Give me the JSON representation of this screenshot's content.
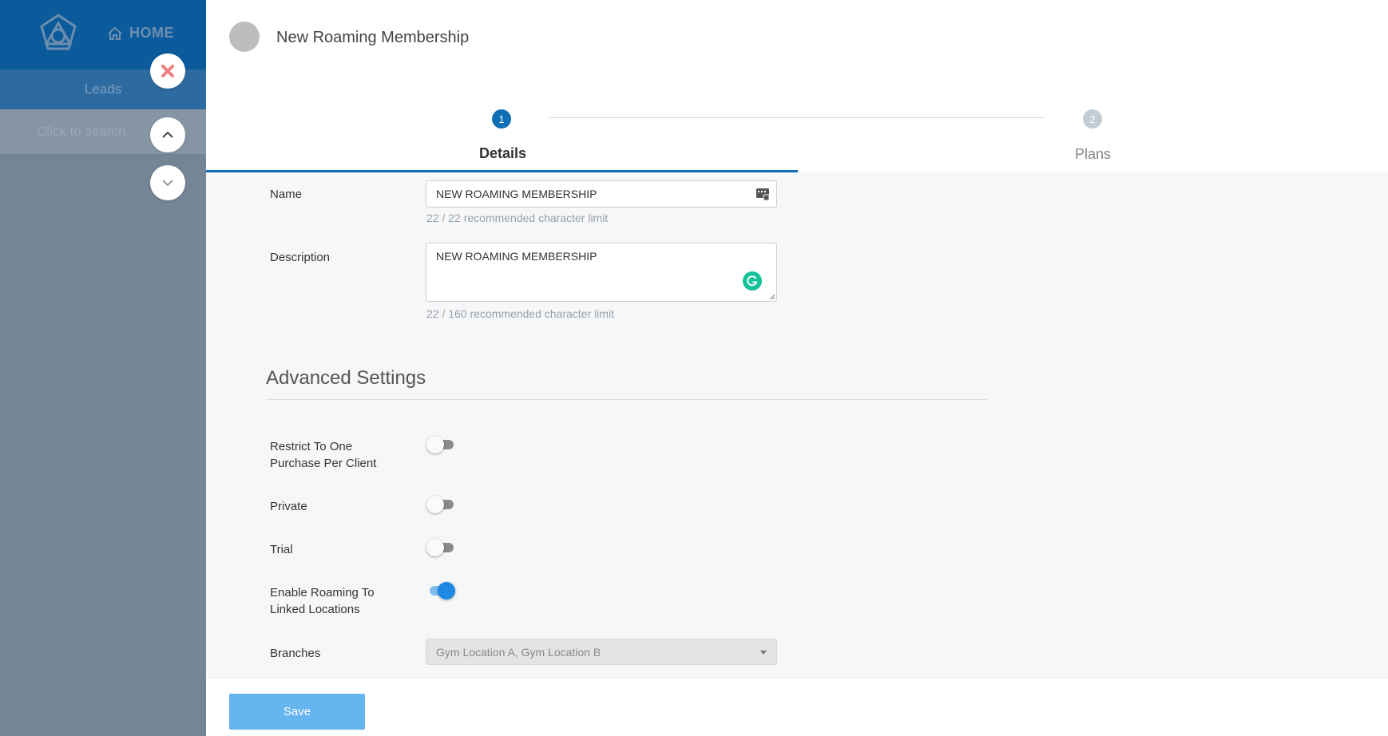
{
  "sidebar": {
    "home_label": "HOME",
    "leads_label": "Leads",
    "search_placeholder": "Click to search"
  },
  "icons": {
    "logo": "brand-logo-icon",
    "home": "home-icon",
    "close": "close-icon",
    "up": "chevron-up-icon",
    "down": "chevron-down-icon",
    "grammarly": "grammarly-icon",
    "password_manager": "password-manager-icon"
  },
  "header": {
    "title": "New Roaming Membership"
  },
  "stepper": {
    "steps": [
      {
        "number": "1",
        "label": "Details",
        "active": true
      },
      {
        "number": "2",
        "label": "Plans",
        "active": false
      }
    ]
  },
  "form": {
    "name": {
      "label": "Name",
      "value": "NEW ROAMING MEMBERSHIP",
      "hint": "22 / 22 recommended character limit"
    },
    "description": {
      "label": "Description",
      "value": "NEW ROAMING MEMBERSHIP",
      "hint": "22 / 160 recommended character limit"
    },
    "advanced": {
      "title": "Advanced Settings",
      "toggles": [
        {
          "label_line1": "Restrict To One",
          "label_line2": "Purchase Per Client",
          "on": false
        },
        {
          "label_line1": "Private",
          "label_line2": "",
          "on": false
        },
        {
          "label_line1": "Trial",
          "label_line2": "",
          "on": false
        },
        {
          "label_line1": "Enable Roaming To",
          "label_line2": "Linked Locations",
          "on": true
        }
      ],
      "branches": {
        "label": "Branches",
        "value": "Gym Location A, Gym Location B"
      }
    }
  },
  "footer": {
    "save_label": "Save"
  },
  "colors": {
    "primary": "#0f6eb5",
    "sidebar_top": "#0a5a9c",
    "toggle_on": "#1e88e5",
    "save_button": "#64b5f0",
    "close_icon": "#f08080",
    "grammarly": "#15c39a"
  }
}
